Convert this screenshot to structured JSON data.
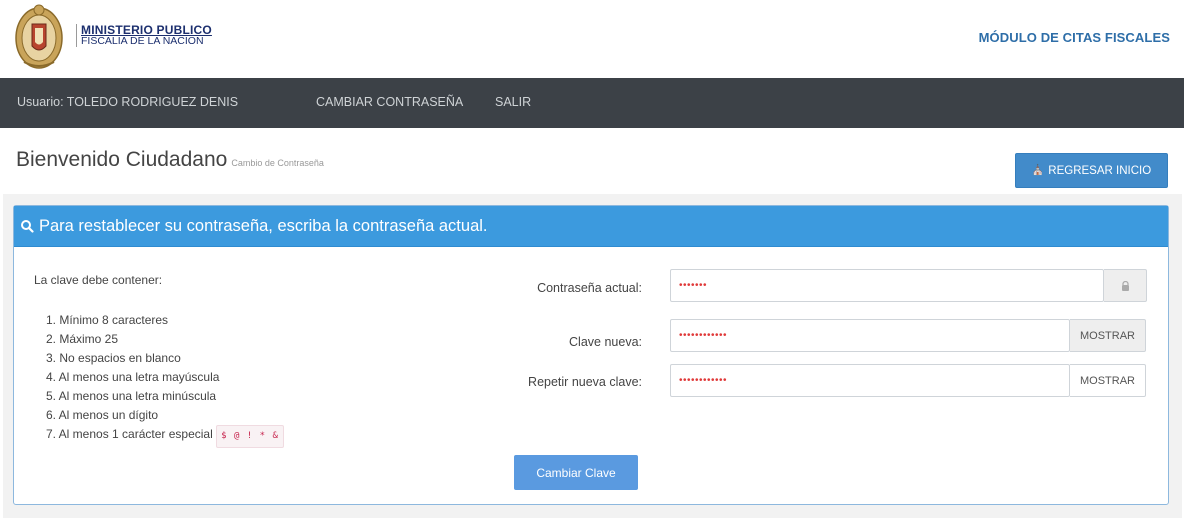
{
  "header": {
    "logo_line1": "MINISTERIO PUBLICO",
    "logo_line2": "FISCALIA DE LA NACION",
    "module_title": "MÓDULO DE CITAS FISCALES"
  },
  "navbar": {
    "user": "Usuario: TOLEDO RODRIGUEZ DENIS",
    "change_password": "CAMBIAR CONTRASEÑA",
    "logout": "SALIR"
  },
  "page": {
    "title": "Bienvenido Ciudadano",
    "subtitle": "Cambio de Contraseña",
    "return_button": "REGRESAR INICIO",
    "icons": {
      "return": "home-icon",
      "heading": "search-icon",
      "lock": "lock-icon"
    }
  },
  "panel": {
    "heading": "Para restablecer su contraseña, escriba la contraseña actual.",
    "rules_title": "La clave debe contener:",
    "rules": [
      "1. Mínimo 8 caracteres",
      "2. Máximo 25",
      "3. No espacios en blanco",
      "4. Al menos una letra mayúscula",
      "5. Al menos una letra minúscula",
      "6. Al menos un dígito",
      "7. Al menos 1 carácter especial"
    ],
    "special_chars": "$ @ ! * &"
  },
  "form": {
    "current_label": "Contraseña actual:",
    "current_value": "•••••••",
    "new_label": "Clave nueva:",
    "new_value": "••••••••••••",
    "new_show": "MOSTRAR",
    "repeat_label": "Repetir nueva clave:",
    "repeat_value": "••••••••••••",
    "repeat_show": "MOSTRAR",
    "submit": "Cambiar Clave"
  },
  "colors": {
    "navbar": "#3c4147",
    "panel_heading": "#3c9ade",
    "primary_button": "#428bca",
    "module_title": "#2e6ea8"
  }
}
